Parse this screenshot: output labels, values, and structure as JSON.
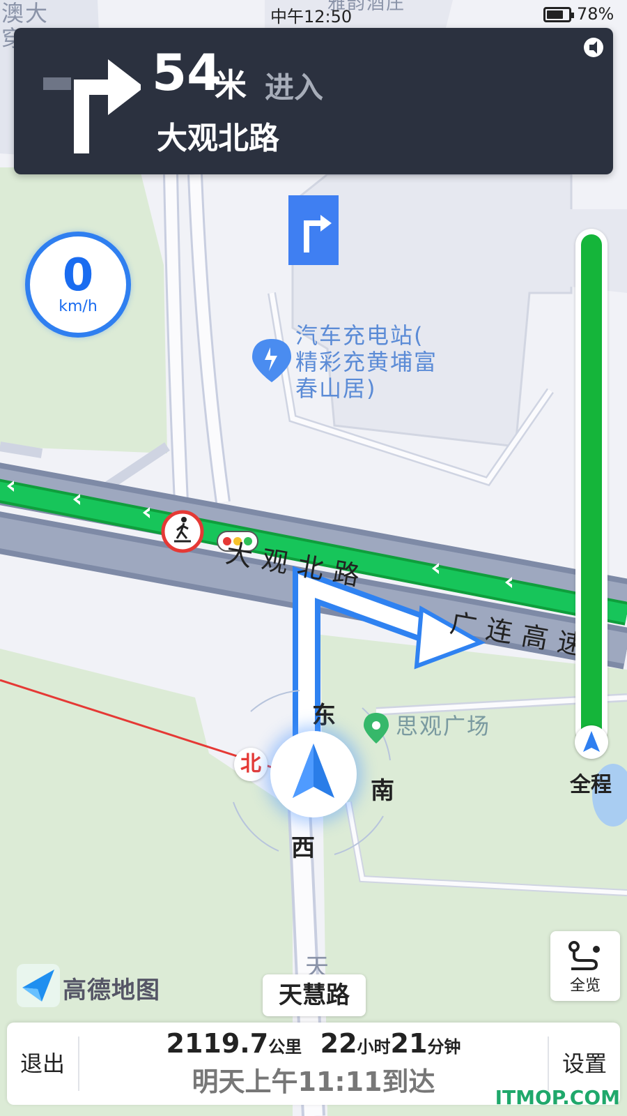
{
  "status_bar": {
    "time": "中午12:50",
    "battery_level": 0.78,
    "battery_percent": "78%"
  },
  "nav_card": {
    "distance": "54",
    "unit": "米",
    "action": "进入",
    "road": "大观北路",
    "turn_icon": "turn-right-icon",
    "voice_icon": "voice-icon"
  },
  "speed": {
    "value": "0",
    "unit": "km/h"
  },
  "map": {
    "labels_top": "雅韵酒庄",
    "label_left": "澳大",
    "label_left2": "穿",
    "poi_charging": [
      "汽车充电站(",
      "精彩充黄埔富",
      "春山居)"
    ],
    "poi_park": "思观广场",
    "road_main": "大观北路",
    "road_expressway": "广连高速",
    "road_south": "天慧"
  },
  "compass": {
    "east": "东",
    "south": "南",
    "west": "西",
    "north": "北"
  },
  "progress": {
    "label": "全程",
    "fraction": 0.0
  },
  "overview_button": {
    "label": "全览"
  },
  "logo": {
    "text": "高德地图"
  },
  "current_road": "天慧路",
  "bottom_bar": {
    "exit_label": "退出",
    "settings_label": "设置",
    "distance_value": "2119.7",
    "distance_unit": "公里",
    "hours_value": "22",
    "hours_unit": "小时",
    "minutes_value": "21",
    "minutes_unit": "分钟",
    "arrival": "明天上午11:11到达"
  },
  "watermark": "ITMOP.COM",
  "colors": {
    "nav_card_bg": "#2b313f",
    "route_green": "#15b53a",
    "accent_blue": "#2f7ff0"
  }
}
